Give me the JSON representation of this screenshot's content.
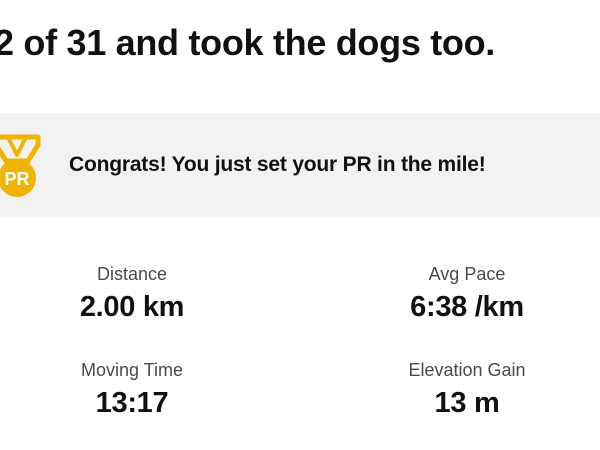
{
  "activity": {
    "title": "2 of 31 and took the dogs too."
  },
  "pr_banner": {
    "message": "Congrats! You just set your PR in the mile!",
    "badge_text": "PR",
    "icon": "pr-medal-icon",
    "accent_color": "#f0b400",
    "background_color": "#f2f2f1"
  },
  "stats": {
    "distance": {
      "label": "Distance",
      "value": "2.00 km"
    },
    "avg_pace": {
      "label": "Avg Pace",
      "value": "6:38 /km"
    },
    "moving_time": {
      "label": "Moving Time",
      "value": "13:17"
    },
    "elevation_gain": {
      "label": "Elevation Gain",
      "value": "13 m"
    }
  }
}
